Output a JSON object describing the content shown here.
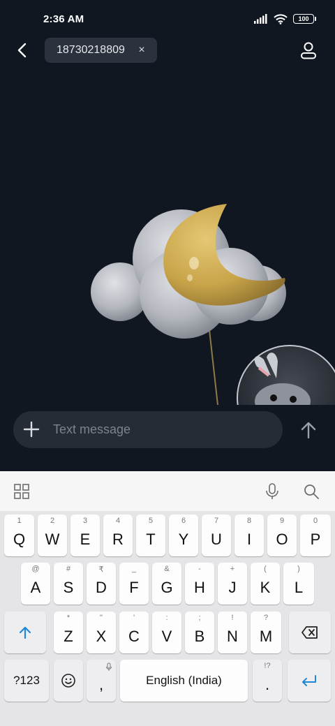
{
  "status": {
    "time": "2:36 AM",
    "battery": "100"
  },
  "header": {
    "recipient": "18730218809",
    "chip_close": "×"
  },
  "compose": {
    "placeholder": "Text message"
  },
  "keyboard": {
    "row1": [
      {
        "hint": "1",
        "key": "Q"
      },
      {
        "hint": "2",
        "key": "W"
      },
      {
        "hint": "3",
        "key": "E"
      },
      {
        "hint": "4",
        "key": "R"
      },
      {
        "hint": "5",
        "key": "T"
      },
      {
        "hint": "6",
        "key": "Y"
      },
      {
        "hint": "7",
        "key": "U"
      },
      {
        "hint": "8",
        "key": "I"
      },
      {
        "hint": "9",
        "key": "O"
      },
      {
        "hint": "0",
        "key": "P"
      }
    ],
    "row2": [
      {
        "hint": "@",
        "key": "A"
      },
      {
        "hint": "#",
        "key": "S"
      },
      {
        "hint": "₹",
        "key": "D"
      },
      {
        "hint": "_",
        "key": "F"
      },
      {
        "hint": "&",
        "key": "G"
      },
      {
        "hint": "-",
        "key": "H"
      },
      {
        "hint": "+",
        "key": "J"
      },
      {
        "hint": "(",
        "key": "K"
      },
      {
        "hint": ")",
        "key": "L"
      }
    ],
    "row3": [
      {
        "hint": "*",
        "key": "Z"
      },
      {
        "hint": "\"",
        "key": "X"
      },
      {
        "hint": "'",
        "key": "C"
      },
      {
        "hint": ":",
        "key": "V"
      },
      {
        "hint": ";",
        "key": "B"
      },
      {
        "hint": "!",
        "key": "N"
      },
      {
        "hint": "?",
        "key": "M"
      }
    ],
    "symbols_label": "?123",
    "comma": ",",
    "space_label": "English (India)",
    "period_hint": "!?",
    "period": "."
  }
}
